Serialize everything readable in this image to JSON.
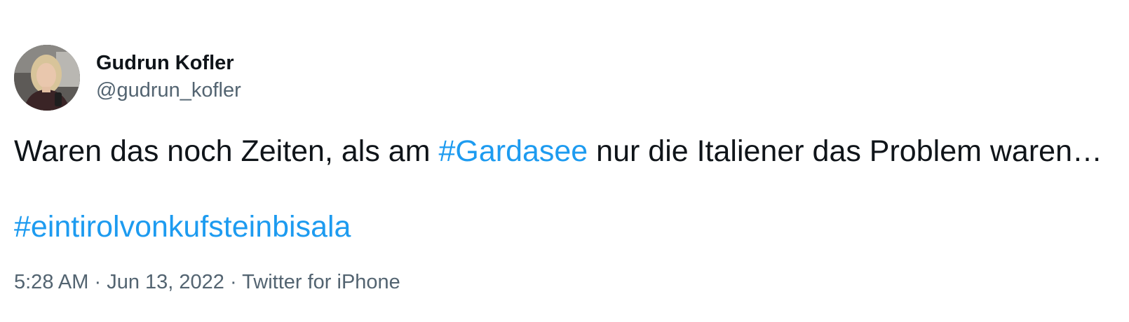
{
  "author": {
    "name": "Gudrun Kofler",
    "handle": "@gudrun_kofler",
    "avatar_icon": "profile-photo"
  },
  "tweet": {
    "text_before_hashtag": "Waren das noch Zeiten, als am ",
    "hashtag_1": "#Gardasee",
    "text_after_hashtag": " nur die Italiener das Problem waren…",
    "hashtag_2": "#eintirolvonkufsteinbisala"
  },
  "meta": {
    "time": "5:28 AM",
    "separator": " · ",
    "date": "Jun 13, 2022",
    "source": "Twitter for iPhone"
  },
  "colors": {
    "text": "#0f1419",
    "secondary": "#536471",
    "link": "#1d9bf0",
    "background": "#ffffff"
  }
}
